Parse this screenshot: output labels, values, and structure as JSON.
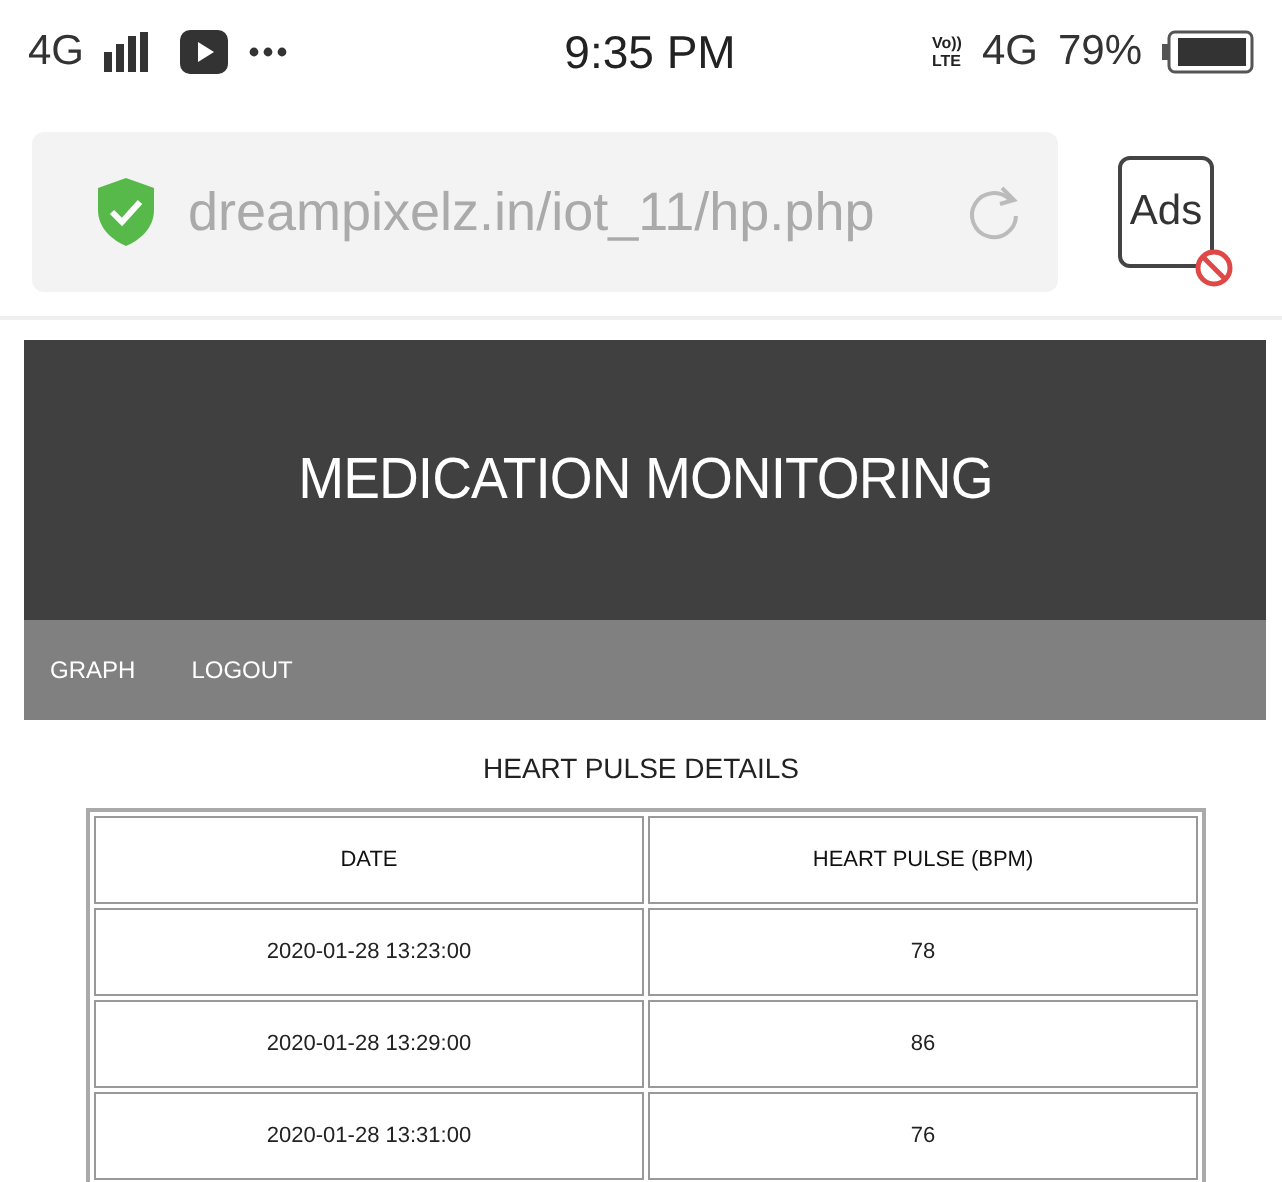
{
  "status_bar": {
    "network": "4G",
    "time": "9:35 PM",
    "volte_top": "Vo))",
    "volte_bottom": "LTE",
    "network_right": "4G",
    "battery": "79%"
  },
  "address_bar": {
    "url": "dreampixelz.in/iot_11/hp.php",
    "ads_label": "Ads"
  },
  "header": {
    "title": "MEDICATION MONITORING"
  },
  "nav": [
    {
      "label": "GRAPH"
    },
    {
      "label": "LOGOUT"
    }
  ],
  "section_title": "HEART PULSE DETAILS",
  "table": {
    "columns": [
      "DATE",
      "HEART PULSE (BPM)"
    ],
    "rows": [
      [
        "2020-01-28 13:23:00",
        "78"
      ],
      [
        "2020-01-28 13:29:00",
        "86"
      ],
      [
        "2020-01-28 13:31:00",
        "76"
      ]
    ]
  }
}
